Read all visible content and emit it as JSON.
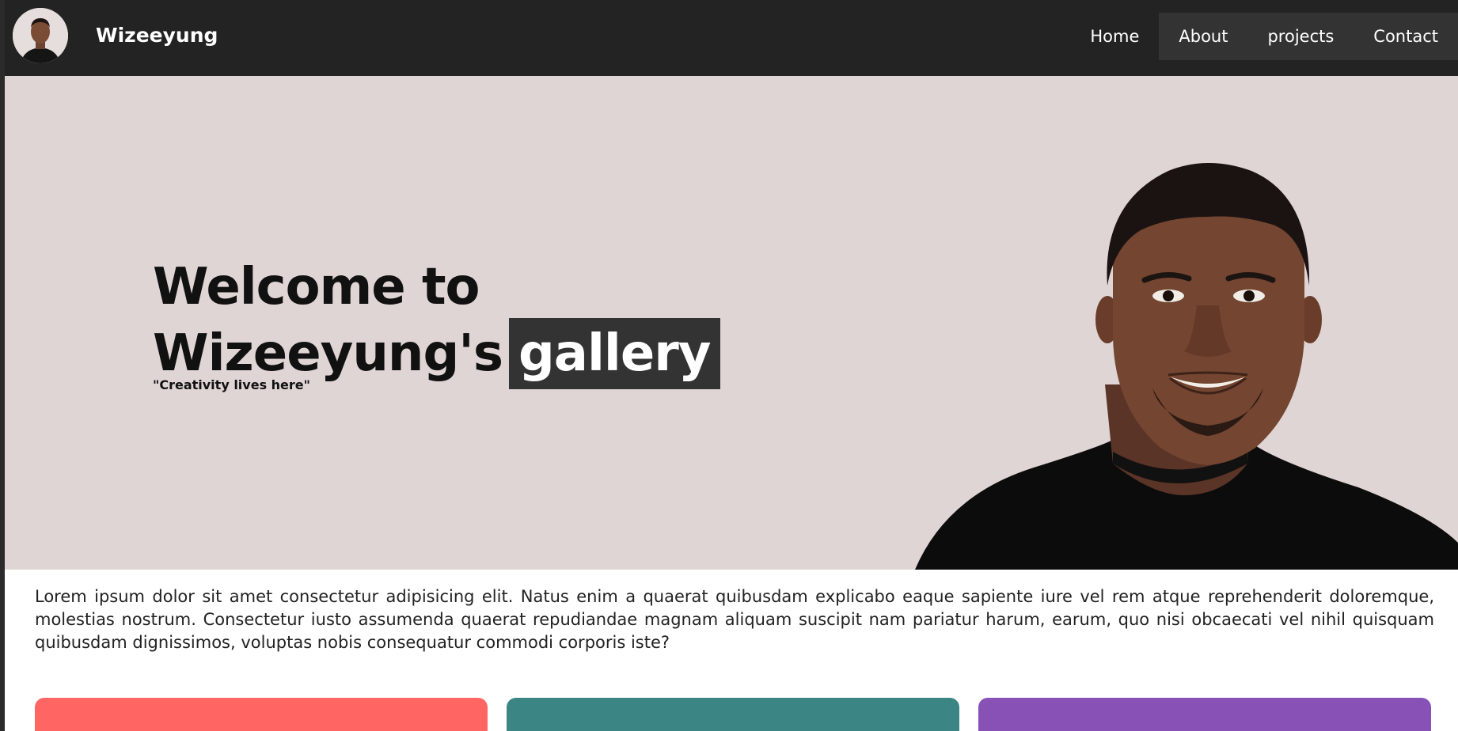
{
  "navbar": {
    "brand": "Wizeeyung",
    "links": [
      {
        "label": "Home"
      },
      {
        "label": "About"
      },
      {
        "label": "projects"
      },
      {
        "label": "Contact"
      }
    ]
  },
  "hero": {
    "title_line1": "Welcome to",
    "title_line2": "Wizeeyung's",
    "title_highlight": "gallery",
    "tagline": "\"Creativity lives here\""
  },
  "intro": {
    "text": "Lorem ipsum dolor sit amet consectetur adipisicing elit. Natus enim a quaerat quibusdam explicabo eaque sapiente iure vel rem atque reprehenderit doloremque, molestias nostrum. Consectetur iusto assumenda quaerat repudiandae magnam aliquam suscipit nam pariatur harum, earum, quo nisi obcaecati vel nihil quisquam quibusdam dignissimos, voluptas nobis consequatur commodi corporis iste?"
  },
  "cards": [
    {
      "color": "#ff6563"
    },
    {
      "color": "#3b8585"
    },
    {
      "color": "#8751b6"
    }
  ],
  "colors": {
    "navbar_bg": "#232323",
    "hero_bg": "#dfd5d4",
    "highlight_bg": "#333333"
  }
}
